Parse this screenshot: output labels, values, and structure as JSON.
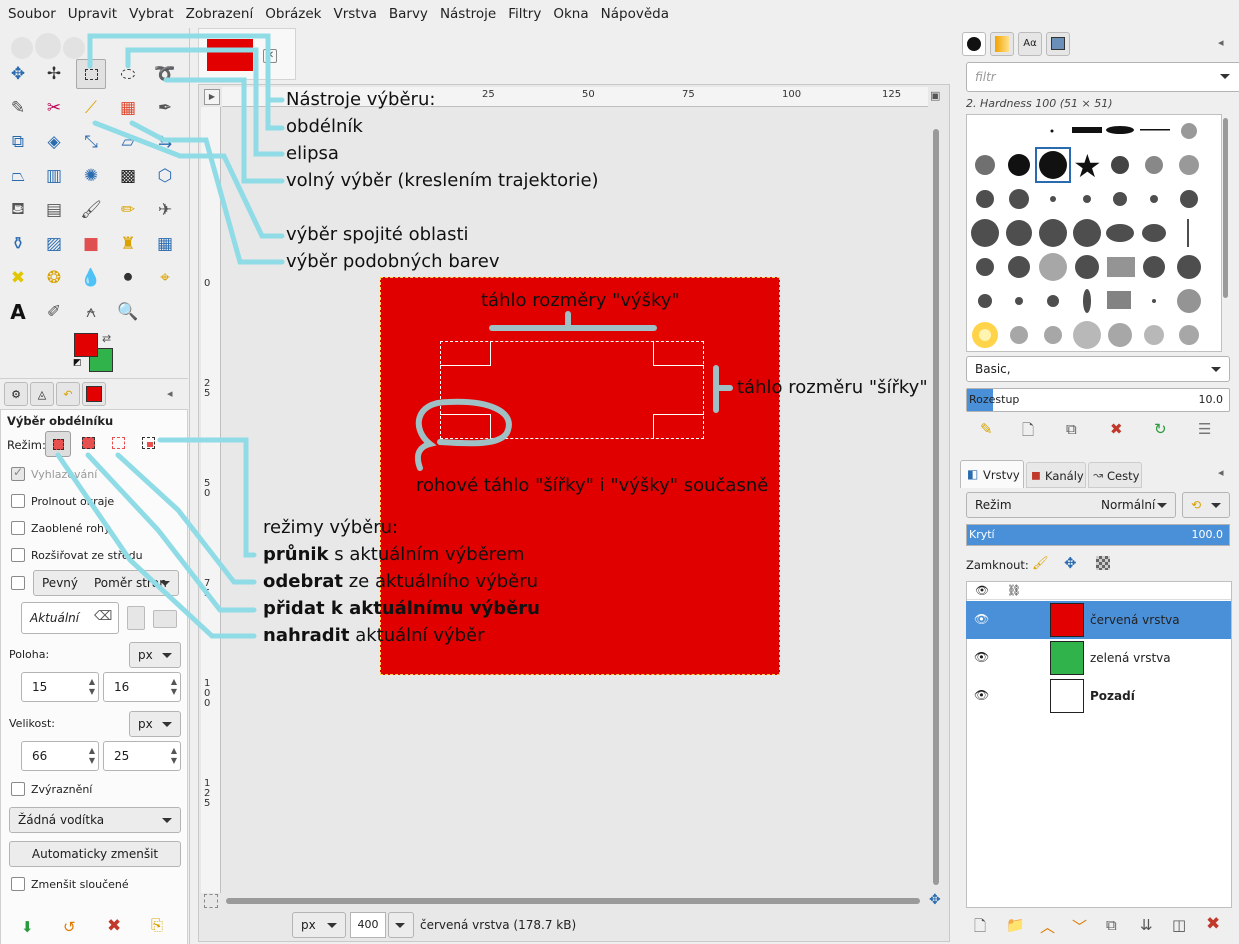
{
  "menu": [
    "Soubor",
    "Upravit",
    "Vybrat",
    "Zobrazení",
    "Obrázek",
    "Vrstva",
    "Barvy",
    "Nástroje",
    "Filtry",
    "Okna",
    "Nápověda"
  ],
  "colors": {
    "foreground": "#e30000",
    "background": "#2fb34a",
    "image": "#e00000",
    "accent": "#4a90d9",
    "annotation_line": "#8fdbe6"
  },
  "tool_options": {
    "title": "Výběr obdélníku",
    "mode_label": "Režim:",
    "antialias": "Vyhlazování",
    "feather": "Prolnout okraje",
    "rounded": "Zaoblené rohy",
    "expand": "Rozšiřovat ze středu",
    "fixed": "Pevný",
    "aspect": "Poměr stran",
    "current": "Aktuální",
    "position_label": "Poloha:",
    "position_unit": "px",
    "pos_x": "15",
    "pos_y": "16",
    "size_label": "Velikost:",
    "size_unit": "px",
    "size_w": "66",
    "size_h": "25",
    "highlight": "Zvýraznění",
    "guides": "Žádná vodítka",
    "autoshrink": "Automaticky zmenšit",
    "shrink_merged": "Zmenšit sloučené"
  },
  "ruler": {
    "h": [
      "25",
      "50",
      "75",
      "100",
      "125"
    ],
    "v": [
      "0",
      "2\n5",
      "5\n0",
      "7\n5",
      "1\n0\n0",
      "1\n2\n5"
    ]
  },
  "status": {
    "unit": "px",
    "zoom": "400 %",
    "info": "červená vrstva (178.7 kB)"
  },
  "annotations": {
    "tools_title": "Nástroje výběru:",
    "rect": "obdélník",
    "ellipse": "elipsa",
    "free": "volný výběr (kreslením trajektorie)",
    "fuzzy": "výběr spojité oblasti",
    "bycolor": "výběr podobných barev",
    "height_handle": "táhlo rozměry \"výšky\"",
    "width_handle": "táhlo rozměru \"šířky\"",
    "corner_handle": "rohové táhlo \"šířky\" i \"výšky\" současně",
    "modes_title": "režimy výběru:",
    "intersect_b": "průnik",
    "intersect": " s aktuálním výběrem",
    "subtract_b": "odebrat",
    "subtract": " ze aktuálního výběru",
    "add_b": "přidat k aktuálnímu výběru",
    "replace_b": "nahradit",
    "replace": " aktuální výběr"
  },
  "brushes": {
    "filter_placeholder": "filtr",
    "current": "2. Hardness 100 (51 × 51)",
    "tag": "Basic,",
    "spacing_label": "Rozestup",
    "spacing_value": "10.0",
    "spacing_fraction": 0.1
  },
  "layers": {
    "tabs": [
      "Vrstvy",
      "Kanály",
      "Cesty"
    ],
    "mode_label": "Režim",
    "mode_value": "Normální",
    "opacity_label": "Krytí",
    "opacity_value": "100.0",
    "opacity_fraction": 1.0,
    "lock_label": "Zamknout:",
    "items": [
      {
        "name": "červená vrstva",
        "color": "#e30000",
        "selected": true,
        "bold": false
      },
      {
        "name": "zelená vrstva",
        "color": "#2fb34a",
        "selected": false,
        "bold": false
      },
      {
        "name": "Pozadí",
        "color": "#ffffff",
        "selected": false,
        "bold": true
      }
    ]
  }
}
